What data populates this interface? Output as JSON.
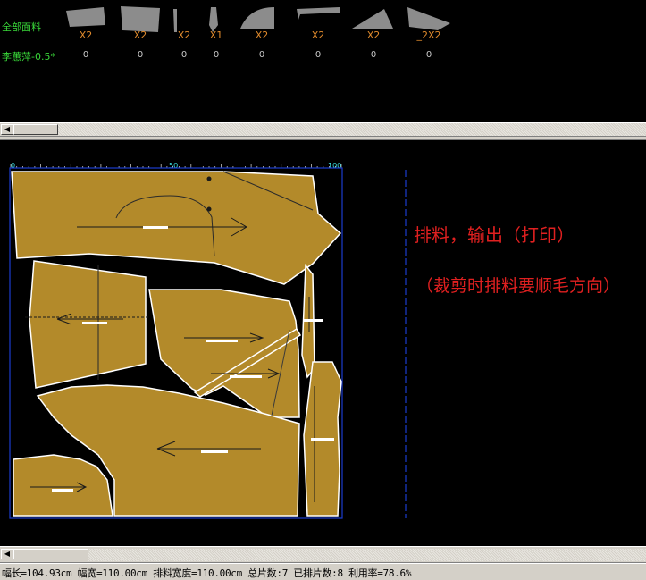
{
  "fabric_bar": {
    "all_fabrics_label": "全部面料",
    "current_fabric_label": "李蕙萍-0.5*",
    "pieces": [
      {
        "qty": "X2",
        "placed": "0"
      },
      {
        "qty": "X2",
        "placed": "0"
      },
      {
        "qty": "X2",
        "placed": "0"
      },
      {
        "qty": "X1",
        "placed": "0"
      },
      {
        "qty": "X2",
        "placed": "0"
      },
      {
        "qty": "X2",
        "placed": "0"
      },
      {
        "qty": "X2",
        "placed": "0"
      },
      {
        "qty": "_2X2",
        "placed": "0"
      }
    ]
  },
  "ruler": {
    "tick_labels": [
      "0",
      "50",
      "100"
    ]
  },
  "marker": {
    "fill_color": "#b38a2a",
    "border_color": "#1a3ccf"
  },
  "notes": {
    "line1": "排料，输出（打印）",
    "line2": "（裁剪时排料要顺毛方向）"
  },
  "status": {
    "text": "幅长=104.93cm 幅宽=110.00cm 排料宽度=110.00cm 总片数:7 已排片数:8 利用率=78.6%"
  }
}
